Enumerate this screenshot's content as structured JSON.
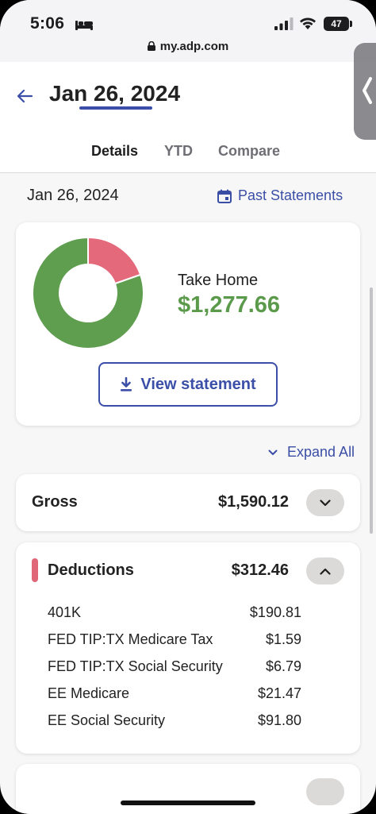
{
  "status_bar": {
    "time": "5:06",
    "battery": "47",
    "url": "my.adp.com"
  },
  "header": {
    "title": "Jan 26, 2024",
    "tabs": [
      {
        "label": "Details",
        "active": true
      },
      {
        "label": "YTD",
        "active": false
      },
      {
        "label": "Compare",
        "active": false
      }
    ]
  },
  "statement": {
    "date": "Jan 26, 2024",
    "past_statements_label": "Past Statements"
  },
  "summary": {
    "take_home_label": "Take Home",
    "take_home_value": "$1,277.66",
    "view_statement_label": "View statement",
    "chart_segments": [
      {
        "name": "Take Home",
        "value": 1277.66,
        "color": "#5e9e4e"
      },
      {
        "name": "Deductions",
        "value": 312.46,
        "color": "#e46a7b"
      }
    ]
  },
  "expand_all_label": "Expand All",
  "gross": {
    "label": "Gross",
    "amount": "$1,590.12"
  },
  "deductions": {
    "label": "Deductions",
    "amount": "$312.46",
    "items": [
      {
        "label": "401K",
        "amount": "$190.81"
      },
      {
        "label": "FED TIP:TX Medicare Tax",
        "amount": "$1.59"
      },
      {
        "label": "FED TIP:TX Social Security",
        "amount": "$6.79"
      },
      {
        "label": "EE Medicare",
        "amount": "$21.47"
      },
      {
        "label": "EE Social Security",
        "amount": "$91.80"
      }
    ]
  },
  "colors": {
    "accent": "#3c4fa8",
    "positive": "#5a9a4a",
    "deduction": "#e06777"
  }
}
